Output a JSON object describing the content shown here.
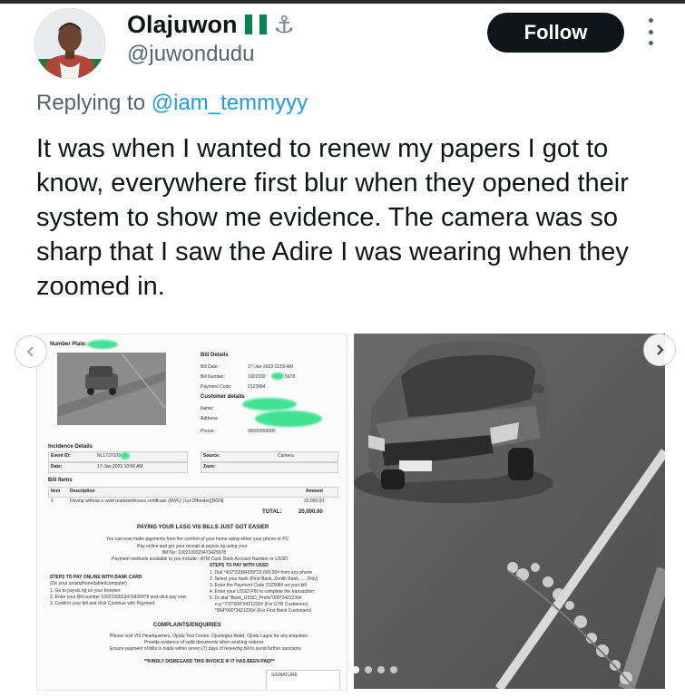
{
  "author": {
    "name": "Olajuwon",
    "flag": "Nigeria flag",
    "anchor_glyph": "⚓",
    "handle": "@juwondudu"
  },
  "follow_label": "Follow",
  "reply": {
    "prefix": "Replying to ",
    "mention": "@iam_temmyyy"
  },
  "tweet_text": "It was when I wanted to renew my papers I got to know, everywhere first blur when they opened their system to show me evidence. The camera was so sharp that I saw the Adire I was wearing when they zoomed in.",
  "invoice": {
    "number_plate_label": "Number Plate:",
    "bill_details_title": "Bill Details",
    "bill_date_label": "Bill Date:",
    "bill_date_value": "17-Jan-2023 11:55 AM",
    "bill_number_label": "Bill Number:",
    "bill_number_value": "1002100",
    "bill_number_tail": "5978",
    "payment_code_label": "Payment Code:",
    "payment_code_value": "2123084",
    "customer_details_title": "Customer details",
    "name_label": "Name:",
    "address_label": "Address:",
    "phone_label": "Phone:",
    "phone_value": "06000000000",
    "incidence_title": "Incidence Details",
    "event_id_label": "Event ID:",
    "event_id_value": "NL1737109",
    "date_label": "Date:",
    "date_value": "17-Jan-2023 10:56 AM",
    "source_label": "Source:",
    "source_value": "Camera",
    "zone_label": "Zone:",
    "bill_items_title": "Bill Items",
    "item_col": "Item",
    "description_col": "Description",
    "amount_col": "Amount",
    "item_number": "1",
    "item_description": "Driving without a valid roadworthiness certificate (RWC) (1st Offender)[NGN]",
    "item_amount": "20,000.00",
    "total_label": "TOTAL:",
    "total_value": "20,000.00",
    "paying_title": "PAYING YOUR LASG VIS BILLS JUST GOT EASIER",
    "paying_line1": "You can now make payments from the comfort of your home using either your phone or PC",
    "paying_line2": "Pay online and get your receipt at payvis.ng using your",
    "paying_line3": "Bill No: 1002100023473425978",
    "paying_line4": "Payment methods available to you include:- ATM Card, Bank Account Number or USSD",
    "bank_card_title": "STEPS TO PAY ONLINE WITH BANK CARD",
    "bank_card_sub": "(On your smartphone/tablet/computer)",
    "bank_steps": [
      "1. Go to payvis.ng on your browser",
      "2. Enter your Bill number 1002100023473425978 and click pay now",
      "3. Confirm your bill and click Continue with Payment"
    ],
    "ussd_title": "STEPS TO PAY WITH USSD",
    "ussd_steps": [
      "1. Dial *402*33384209*20,000.00# from any phone",
      "2. Select your bank (First Bank, Zenith Bank, .... Only)",
      "3. Enter the Payment Code 2123084 on your bill",
      "4. Enter your USSD PIN to complete the transaction",
      "5. Or dial *Bank_USSD_Prefix*000*2421230#",
      "e.g *737*000*2421230# (For GTB Customers)",
      "*894*000*2421230# (For First Bank Customers)"
    ],
    "complaints_title": "COMPLAINTS/ENQUIRIES",
    "complaints_lines": [
      "Please visit VIS Headquarters, Ojodu Test Centre, Ojuelegba Road, Ojodu Lagos for any enquiries",
      "Provide evidence of valid documents when seeking redress",
      "Ensure payment of bills is made within seven (7) days of receiving bill to avoid further sanctions"
    ],
    "disregard": "**KINDLY DISREGARD THIS INVOICE IF IT HAS BEEN PAID**",
    "signature_label": "SIGNATURE"
  },
  "colors": {
    "accent": "#1d9bf0",
    "text": "#0f1419",
    "muted": "#536471",
    "button": "#0f1419",
    "highlight_blur": "#2fe08a"
  },
  "icons": {
    "more": "vertical-ellipsis",
    "prev": "chevron-left",
    "next": "chevron-right"
  },
  "media_count": 4,
  "media_active_index": 1
}
